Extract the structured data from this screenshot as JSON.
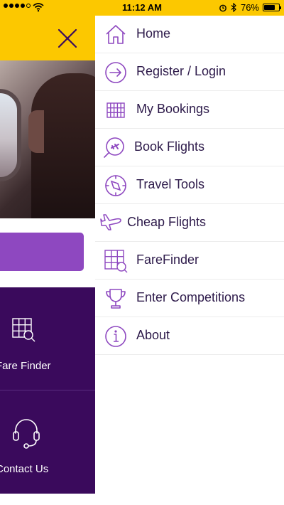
{
  "status_bar": {
    "time": "11:12 AM",
    "battery": "76%",
    "battery_level": 0.76
  },
  "main": {
    "tiles": [
      {
        "label": "Fare Finder",
        "icon": "farefinder-icon"
      },
      {
        "label": "Contact Us",
        "icon": "headset-icon"
      }
    ]
  },
  "menu": {
    "items": [
      {
        "label": "Home",
        "icon": "home-icon"
      },
      {
        "label": "Register / Login",
        "icon": "arrow-circle-icon"
      },
      {
        "label": "My Bookings",
        "icon": "grid-icon"
      },
      {
        "label": "Book Flights",
        "icon": "plane-search-icon"
      },
      {
        "label": "Travel Tools",
        "icon": "compass-icon"
      },
      {
        "label": "Cheap Flights",
        "icon": "plane-icon"
      },
      {
        "label": "FareFinder",
        "icon": "farefinder-icon"
      },
      {
        "label": "Enter Competitions",
        "icon": "trophy-icon"
      },
      {
        "label": "About",
        "icon": "info-icon"
      }
    ]
  },
  "colors": {
    "accent_yellow": "#fcc800",
    "brand_purple": "#3a0a5c",
    "button_purple": "#8e48c0",
    "icon_purple": "#8e48c0"
  }
}
